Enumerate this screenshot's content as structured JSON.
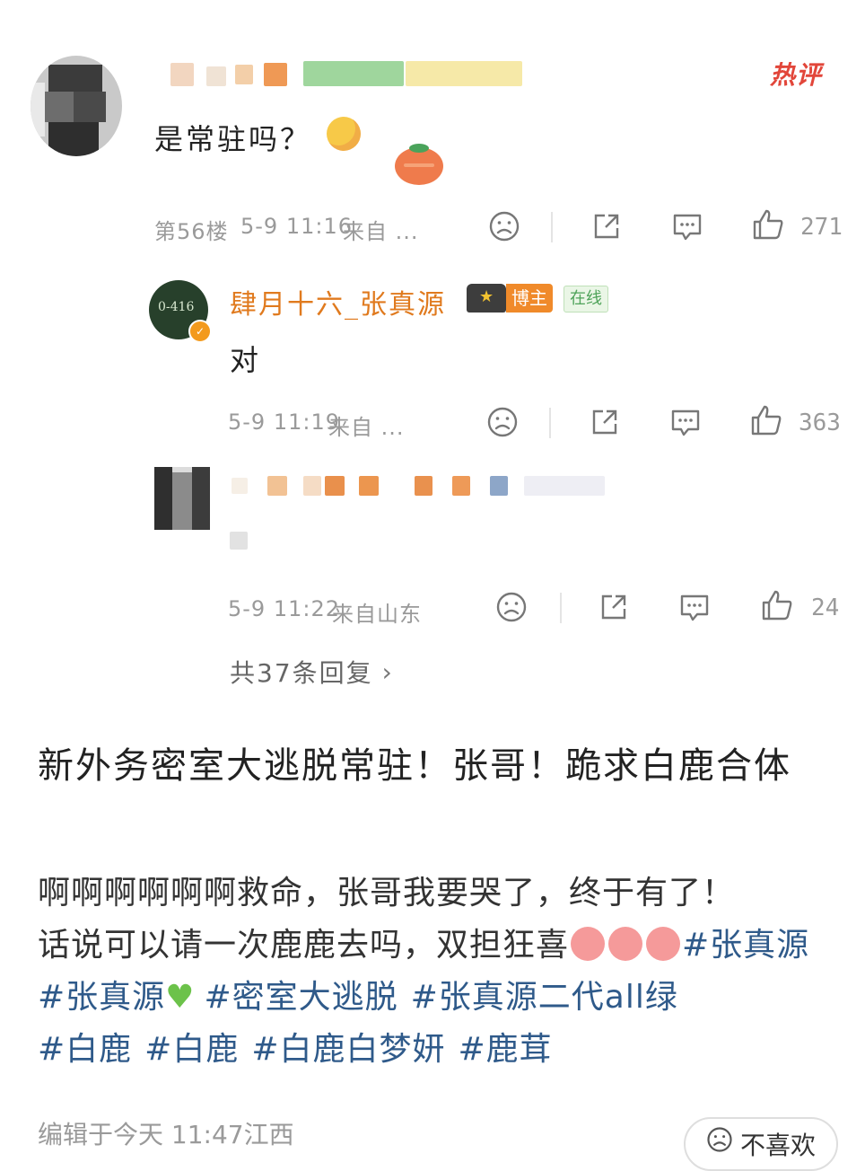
{
  "hot_badge": "热评",
  "comment": {
    "text": "是常驻吗？",
    "floor": "第56楼",
    "time": "5-9 11:16",
    "source": "来自 ...",
    "likes": "271"
  },
  "reply1": {
    "username": "肆月十六_张真源",
    "avatar_text": "0-416",
    "blogger_badge": "博主",
    "online_badge": "在线",
    "text": "对",
    "time": "5-9 11:19",
    "source": "来自 ...",
    "likes": "363"
  },
  "reply2": {
    "time": "5-9 11:22",
    "source": "来自山东",
    "likes": "24"
  },
  "total_replies": "共37条回复",
  "post": {
    "title": "新外务密室大逃脱常驻！张哥！跪求白鹿合体",
    "line1": "啊啊啊啊啊啊救命，张哥我要哭了，终于有了！",
    "line2": "话说可以请一次鹿鹿去吗，双担狂喜",
    "tag1": "#张真源",
    "tag2": "#张真源",
    "tag3": "#密室大逃脱",
    "tag4": "#张真源二代all绿",
    "tag5": "#白鹿",
    "tag6": "#白鹿",
    "tag7": "#白鹿白梦妍",
    "tag8": "#鹿茸",
    "edited": "编辑于今天 11:47江西",
    "dislike_label": "不喜欢"
  },
  "colors": {
    "hot_red": "#e2463a",
    "username_orange": "#e07a1e",
    "hashtag_blue": "#2f5a8a"
  }
}
